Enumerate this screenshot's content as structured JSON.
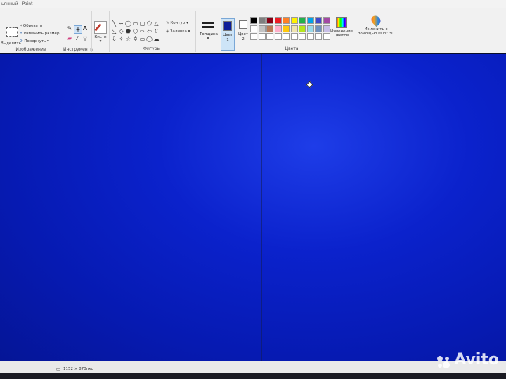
{
  "window": {
    "title": "ьянный - Paint"
  },
  "ribbon": {
    "image_group": {
      "select_label": "Выделить",
      "crop_label": "Обрезать",
      "resize_label": "Изменить размер",
      "rotate_label": "Повернуть",
      "group_label": "Изображение"
    },
    "tools_group": {
      "group_label": "Инструменты"
    },
    "brushes": {
      "label": "Кисти"
    },
    "shapes_group": {
      "outline_label": "Контур",
      "fill_label": "Заливка",
      "group_label": "Фигуры"
    },
    "thickness": {
      "label": "Толщина"
    },
    "color1": {
      "label_line1": "Цвет",
      "label_line2": "1",
      "color": "#0b1e9a"
    },
    "color2": {
      "label_line1": "Цвет",
      "label_line2": "2",
      "color": "#ffffff"
    },
    "palette": {
      "row1": [
        "#000000",
        "#7f7f7f",
        "#880015",
        "#ed1c24",
        "#ff7f27",
        "#fff200",
        "#22b14c",
        "#00a2e8",
        "#3f48cc",
        "#a349a4"
      ],
      "row2": [
        "#ffffff",
        "#c3c3c3",
        "#b97a57",
        "#ffaec9",
        "#ffc90e",
        "#efe4b0",
        "#b5e61d",
        "#99d9ea",
        "#7092be",
        "#c8bfe7"
      ],
      "row3": [
        "#ffffff",
        "#ffffff",
        "#ffffff",
        "#ffffff",
        "#ffffff",
        "#ffffff",
        "#ffffff",
        "#ffffff",
        "#ffffff",
        "#ffffff"
      ],
      "group_label": "Цвета"
    },
    "edit_colors": {
      "label_line1": "Изменение",
      "label_line2": "цветов"
    },
    "paint3d": {
      "label_line1": "Изменить с",
      "label_line2": "помощью Paint 3D"
    }
  },
  "canvas": {
    "background_color": "#0b22cc"
  },
  "statusbar": {
    "dimensions": "1152 × 870пкс"
  },
  "watermark": {
    "text": "Avito"
  }
}
